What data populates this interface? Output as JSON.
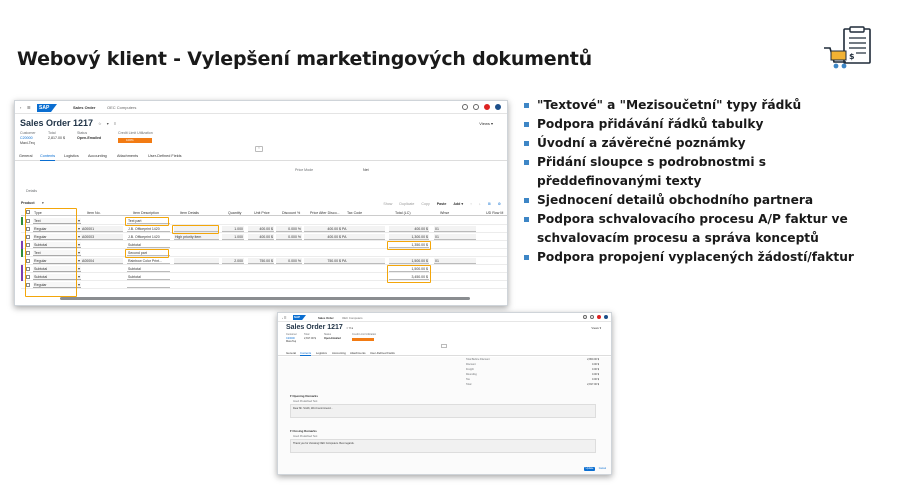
{
  "slide": {
    "title": "Webový klient - Vylepšení marketingových dokumentů",
    "logo_icon": "document-cart-icon",
    "bullets": [
      "\"Textové\" a \"Mezisoučetní\" typy řádků",
      "Podpora přidávání řádků tabulky",
      "Úvodní a závěrečné poznámky",
      "Přidání sloupce s podrobnostmi s předdefinovanými texty",
      "Sjednocení detailů obchodního partnera",
      "Podpora schvalovacího procesu A/P faktur ve schvalovacím procesu a správa konceptů",
      "Podpora propojení vyplacených žádostí/faktur"
    ],
    "bullet_color": "#3d86c6"
  },
  "shot1": {
    "topbar": {
      "back": "‹",
      "menu": "☰",
      "sap": "SAP",
      "app": "Sales Order",
      "company": "OEC Computers"
    },
    "title": "Sales Order 1217",
    "title_controls": "☆ ▾ ≡",
    "views": "Views ▾",
    "header": {
      "customer_label": "Customer",
      "customer_value": "C20000",
      "customer_sub": "Maxi-Teq",
      "total_label": "Total",
      "total_value": "2,817.00 $",
      "status_label": "Status",
      "status_value": "Open-Emailed",
      "risk_label": "Credit Limit Utilization",
      "risk_value": "100%",
      "risk_fraction": 1.0
    },
    "tabs": [
      "General",
      "Contents",
      "Logistics",
      "Accounting",
      "Attachments",
      "User-Defined Fields"
    ],
    "active_tab": "Contents",
    "price_mode_label": "Price Mode",
    "price_mode_value": "Net",
    "details_label": "Details",
    "product_label": "Product",
    "toolbar": [
      "Show",
      "Duplicate",
      "Copy",
      "Paste",
      "Add ▾",
      "↑",
      "↓",
      "⊞",
      "⚙"
    ],
    "columns": [
      "Type",
      "Item No.",
      "Item Description",
      "Item Details",
      "Quantity",
      "Unit Price",
      "Discount %",
      "Price After Disco...",
      "Tax Code",
      "Total (LC)",
      "Whse",
      "UD Row M"
    ],
    "rows": [
      {
        "type": "Text",
        "color": "#2e8b3a",
        "desc": "Text part"
      },
      {
        "type": "Regular",
        "color": "",
        "item": "A00001",
        "desc": "J.B. Officeprint 1420",
        "details": "",
        "qty": "1.000",
        "price": "400.00 $",
        "disc": "0.000 %",
        "after": "400.00 $",
        "tax": "PA",
        "total": "400.00 $",
        "whse": "01"
      },
      {
        "type": "Regular",
        "color": "",
        "item": "A00003",
        "desc": "J.B. Officeprint 1420",
        "details": "High priority item",
        "qty": "1.000",
        "price": "400.00 $",
        "disc": "0.000 %",
        "after": "400.00 $",
        "tax": "PA",
        "total": "1,300.00 $",
        "whse": "01"
      },
      {
        "type": "Subtotal",
        "color": "#7b3fb2",
        "desc": "Subtotal",
        "total": "1,350.00 $"
      },
      {
        "type": "Text",
        "color": "#2e8b3a",
        "desc": "Second part"
      },
      {
        "type": "Regular",
        "color": "",
        "item": "A00004",
        "desc": "Rainbow Color Print...",
        "details": "",
        "qty": "2.000",
        "price": "750.00 $",
        "disc": "0.000 %",
        "after": "750.00 $",
        "tax": "PA",
        "total": "1,500.00 $",
        "whse": "01"
      },
      {
        "type": "Subtotal",
        "color": "#7b3fb2",
        "desc": "Subtotal",
        "total": "1,500.00 $"
      },
      {
        "type": "Subtotal",
        "color": "#7b3fb2",
        "desc": "Subtotal",
        "total": "3,450.00 $"
      },
      {
        "type": "Regular",
        "color": "",
        "desc": ""
      }
    ]
  },
  "shot2": {
    "topbar": {
      "sap": "SAP",
      "app": "Sales Order",
      "company": "OEC Computers"
    },
    "title": "Sales Order 1217",
    "title_controls": "☆ ▾ ≡",
    "views": "Views ▾",
    "header": {
      "customer_label": "Customer",
      "customer_value": "C20000",
      "customer_sub": "Maxi-Teq",
      "total_label": "Total",
      "total_value": "2,817.00 $",
      "status_label": "Status",
      "status_value": "Open-Emailed",
      "risk_label": "Credit Limit Utilization",
      "risk_fraction": 1.0
    },
    "tabs": [
      "General",
      "Contents",
      "Logistics",
      "Accounting",
      "Attachments",
      "User-Defined Fields"
    ],
    "totals": [
      {
        "k": "Total Before Discount",
        "v": "2,800.00 $"
      },
      {
        "k": "Discount",
        "v": "0.00 $"
      },
      {
        "k": "Freight",
        "v": "0.00 $"
      },
      {
        "k": "Rounding",
        "v": "0.00 $"
      },
      {
        "k": "Tax",
        "v": "0.00 $"
      },
      {
        "k": "Total",
        "v": "2,817.00 $"
      }
    ],
    "opening_title": "Opening Remarks",
    "opening_sub": "Insert Predefined Text",
    "opening_text": "Dear Mr. Smith, We'd recommend...",
    "closing_title": "Closing Remarks",
    "closing_sub": "Insert Predefined Text",
    "closing_text": "Thank you for choosing OEC Computers. Best regards.",
    "btn_update": "Update",
    "btn_cancel": "Cancel"
  }
}
